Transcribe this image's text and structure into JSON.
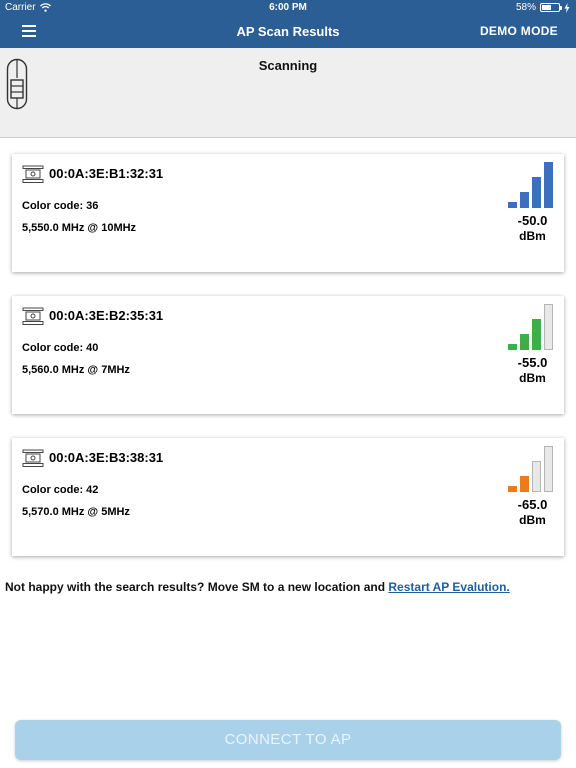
{
  "status_bar": {
    "carrier": "Carrier",
    "time": "6:00 PM",
    "battery": "58%",
    "battery_level": 0.58
  },
  "nav": {
    "title": "AP Scan Results",
    "demo_label": "DEMO MODE"
  },
  "scan": {
    "status": "Scanning"
  },
  "cards": [
    {
      "mac": "00:0A:3E:B1:32:31",
      "color_code": "Color code: 36",
      "frequency": "5,550.0 MHz @ 10MHz",
      "dbm": "-50.0",
      "unit": "dBm",
      "active_bars": 4,
      "color": "#3d6fbf"
    },
    {
      "mac": "00:0A:3E:B2:35:31",
      "color_code": "Color code: 40",
      "frequency": "5,560.0 MHz @ 7MHz",
      "dbm": "-55.0",
      "unit": "dBm",
      "active_bars": 3,
      "color": "#3fae4a"
    },
    {
      "mac": "00:0A:3E:B3:38:31",
      "color_code": "Color code: 42",
      "frequency": "5,570.0 MHz @ 5MHz",
      "dbm": "-65.0",
      "unit": "dBm",
      "active_bars": 2,
      "color": "#ea7c1f"
    }
  ],
  "footer": {
    "message": "Not happy with the search results? Move SM to a new location and ",
    "link": "Restart AP Evalution."
  },
  "connect_button": {
    "label": "CONNECT TO AP"
  }
}
